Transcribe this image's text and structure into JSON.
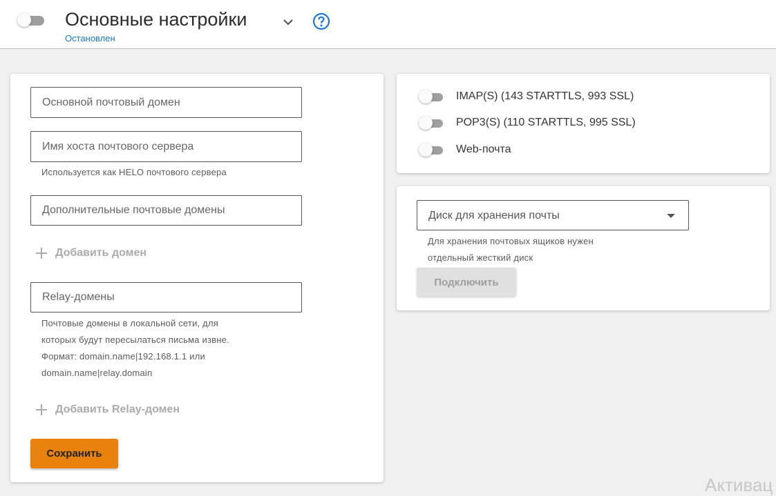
{
  "header": {
    "title": "Основные настройки",
    "status": "Остановлен",
    "status_color": "#1976d2",
    "toggle_on": false,
    "icons": [
      "chevron-down-icon",
      "help-circle-icon"
    ]
  },
  "left_card": {
    "primary_domain_placeholder": "Основной почтовый домен",
    "hostname_placeholder": "Имя хоста почтового сервера",
    "hostname_hint": "Используется как HELO почтового сервера",
    "extra_domains_placeholder": "Дополнительные почтовые домены",
    "add_domain_label": "Добавить домен",
    "relay_placeholder": "Relay-домены",
    "relay_hint_lines": [
      "Почтовые домены в локальной сети, для",
      "которых будут пересылаться письма извне.",
      "Формат: domain.name|192.168.1.1 или",
      "domain.name|relay.domain"
    ],
    "add_relay_label": "Добавить Relay-домен",
    "save_label": "Сохранить",
    "save_color": "#e8820c"
  },
  "services": [
    {
      "label": "IMAP(S) (143 STARTTLS, 993 SSL)",
      "enabled": false
    },
    {
      "label": "POP3(S) (110 STARTTLS, 995 SSL)",
      "enabled": false
    },
    {
      "label": "Web-почта",
      "enabled": false
    }
  ],
  "storage_card": {
    "disk_select_value": "Диск для хранения почты",
    "hint_lines": [
      "Для хранения почтовых ящиков нужен",
      "отдельный жесткий диск"
    ],
    "connect_label": "Подключить"
  },
  "watermark": "Активац"
}
